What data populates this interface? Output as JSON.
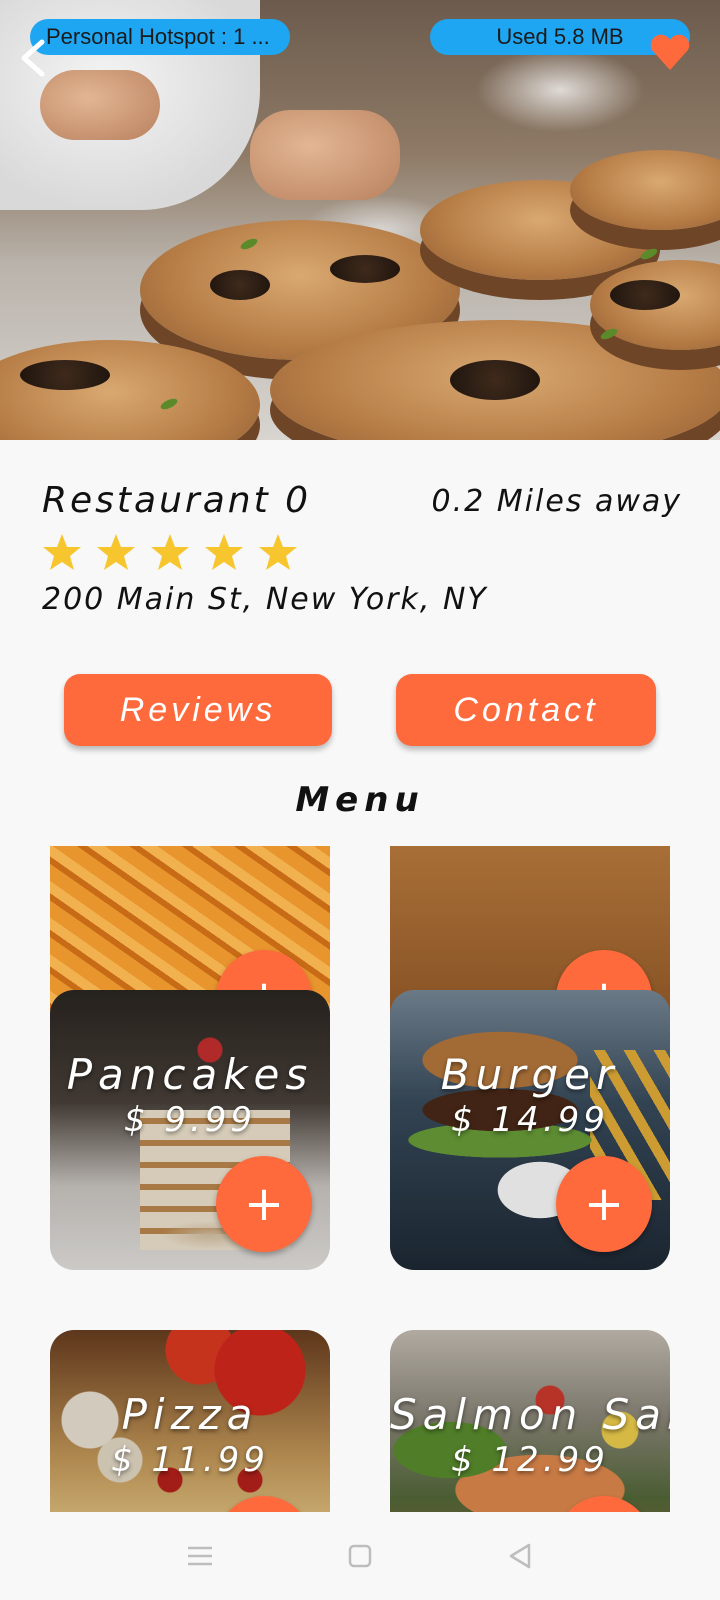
{
  "status": {
    "hotspot_text": "Personal Hotspot : 1 ...",
    "data_used_text": "Used  5.8 MB"
  },
  "icons": {
    "back": "chevron-left-icon",
    "favorite": "heart-icon",
    "star": "star-icon",
    "add": "plus-icon",
    "nav_menu": "hamburger-icon",
    "nav_home": "square-icon",
    "nav_back": "triangle-back-icon"
  },
  "restaurant": {
    "name": "Restaurant 0",
    "distance": "0.2 Miles away",
    "rating": 5,
    "rating_max": 5,
    "address": "200 Main St, New York, NY"
  },
  "actions": {
    "reviews_label": "Reviews",
    "contact_label": "Contact"
  },
  "menu": {
    "title": "Menu",
    "add_label": "+",
    "items": [
      {
        "name": "",
        "price": ""
      },
      {
        "name": "",
        "price": ""
      },
      {
        "name": "Pancakes",
        "price": "$ 9.99"
      },
      {
        "name": "Burger",
        "price": "$ 14.99"
      },
      {
        "name": "Pizza",
        "price": "$ 11.99"
      },
      {
        "name": "Salmon Salad",
        "price": "$ 12.99"
      }
    ]
  },
  "colors": {
    "accent": "#ff6a3d",
    "status_pill": "#1fa6f2",
    "star": "#f7c62f",
    "background": "#f8f8f8"
  }
}
